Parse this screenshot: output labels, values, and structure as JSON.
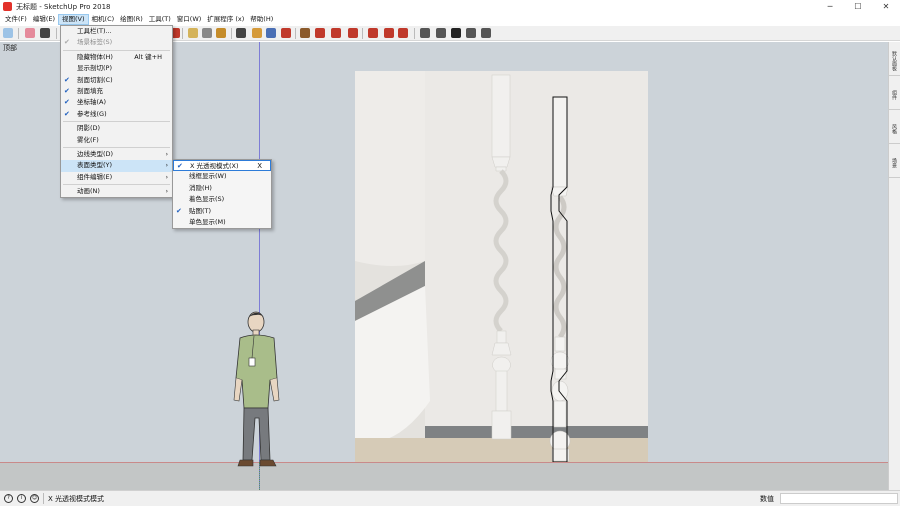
{
  "window": {
    "title": "无标题 - SketchUp Pro 2018",
    "minimize": "─",
    "maximize": "☐",
    "close": "✕"
  },
  "menubar": [
    {
      "label": "文件(F)",
      "active": false
    },
    {
      "label": "编辑(E)",
      "active": false
    },
    {
      "label": "视图(V)",
      "active": true
    },
    {
      "label": "相机(C)",
      "active": false
    },
    {
      "label": "绘图(R)",
      "active": false
    },
    {
      "label": "工具(T)",
      "active": false
    },
    {
      "label": "窗口(W)",
      "active": false
    },
    {
      "label": "扩展程序 (x)",
      "active": false
    },
    {
      "label": "帮助(H)",
      "active": false
    }
  ],
  "scene": {
    "label": "顶部"
  },
  "view_menu": {
    "groups": [
      [
        {
          "label": "工具栏(T)...",
          "checked": false,
          "disabled": false,
          "submenu": false,
          "shortcut": ""
        },
        {
          "label": "场景标签(S)",
          "checked": true,
          "disabled": true,
          "submenu": false,
          "shortcut": ""
        }
      ],
      [
        {
          "label": "隐藏物体(H)",
          "checked": false,
          "disabled": false,
          "submenu": false,
          "shortcut": "Alt 键+H"
        },
        {
          "label": "显示剖切(P)",
          "checked": false,
          "disabled": false,
          "submenu": false,
          "shortcut": ""
        },
        {
          "label": "剖面切割(C)",
          "checked": true,
          "disabled": false,
          "submenu": false,
          "shortcut": ""
        },
        {
          "label": "剖面填充",
          "checked": true,
          "disabled": false,
          "submenu": false,
          "shortcut": ""
        },
        {
          "label": "坐标轴(A)",
          "checked": true,
          "disabled": false,
          "submenu": false,
          "shortcut": ""
        },
        {
          "label": "参考线(G)",
          "checked": true,
          "disabled": false,
          "submenu": false,
          "shortcut": ""
        }
      ],
      [
        {
          "label": "阴影(D)",
          "checked": false,
          "disabled": false,
          "submenu": false,
          "shortcut": ""
        },
        {
          "label": "雾化(F)",
          "checked": false,
          "disabled": false,
          "submenu": false,
          "shortcut": ""
        }
      ],
      [
        {
          "label": "边线类型(D)",
          "checked": false,
          "disabled": false,
          "submenu": true,
          "shortcut": ""
        },
        {
          "label": "表面类型(Y)",
          "checked": false,
          "disabled": false,
          "submenu": true,
          "highlight": true,
          "shortcut": ""
        },
        {
          "label": "组件编辑(E)",
          "checked": false,
          "disabled": false,
          "submenu": true,
          "shortcut": ""
        }
      ],
      [
        {
          "label": "动画(N)",
          "checked": false,
          "disabled": false,
          "submenu": true,
          "shortcut": ""
        }
      ]
    ]
  },
  "face_style_submenu": {
    "items": [
      {
        "label": "X 光透视模式(X)",
        "checked": true,
        "close": "X"
      },
      {
        "label": "线框显示(W)",
        "checked": false,
        "close": ""
      },
      {
        "label": "消隐(H)",
        "checked": false,
        "close": ""
      },
      {
        "label": "着色显示(S)",
        "checked": false,
        "close": ""
      },
      {
        "label": "贴图(T)",
        "checked": true,
        "close": ""
      },
      {
        "label": "单色显示(M)",
        "checked": false,
        "close": ""
      }
    ]
  },
  "right_tray": {
    "tabs": [
      "默认面板",
      "组件",
      "风格",
      "场景"
    ]
  },
  "statusbar": {
    "icons": [
      "?",
      "i",
      "☺"
    ],
    "message": "X 光透视模式模式",
    "measurement_label": "数值",
    "measurement_value": ""
  },
  "colors": {
    "viewport_bg": "#ccd3d9",
    "ground": "#c3c6c6",
    "red_axis": "#c98a8a",
    "blue_axis": "#7d7dd6",
    "menu_highlight": "#cce4f7",
    "check": "#1f5fbf"
  }
}
